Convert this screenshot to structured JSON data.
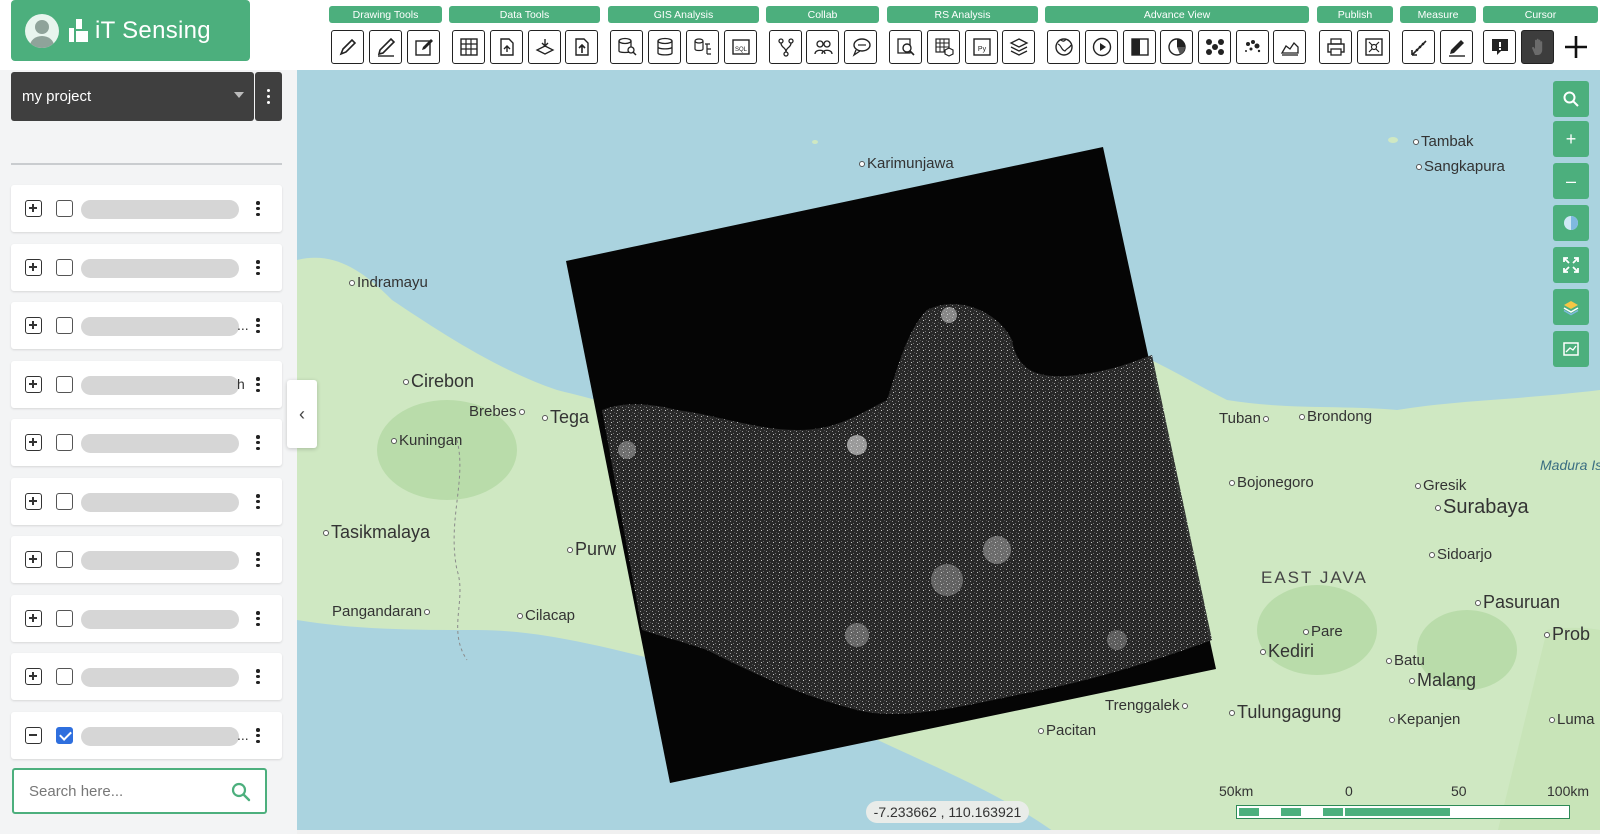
{
  "app": {
    "title": "iT Sensing"
  },
  "project": {
    "name": "my project"
  },
  "toolbar_groups": [
    "Drawing Tools",
    "Data Tools",
    "GIS Analysis",
    "Collab",
    "RS Analysis",
    "Advance View",
    "Publish",
    "Measure",
    "Cursor"
  ],
  "layers": [
    {
      "tail": "",
      "expanded": false,
      "checked": false
    },
    {
      "tail": "",
      "expanded": false,
      "checked": false
    },
    {
      "tail": "...",
      "expanded": false,
      "checked": false
    },
    {
      "tail": "h",
      "expanded": false,
      "checked": false
    },
    {
      "tail": "",
      "expanded": false,
      "checked": false
    },
    {
      "tail": "",
      "expanded": false,
      "checked": false
    },
    {
      "tail": "",
      "expanded": false,
      "checked": false
    },
    {
      "tail": "",
      "expanded": false,
      "checked": false
    },
    {
      "tail": "",
      "expanded": false,
      "checked": false
    },
    {
      "tail": "...",
      "expanded": true,
      "checked": true
    }
  ],
  "search": {
    "placeholder": "Search here..."
  },
  "map": {
    "places": {
      "karimunjawa": "Karimunjawa",
      "tambak": "Tambak",
      "sangkapura": "Sangkapura",
      "indramayu": "Indramayu",
      "cirebon": "Cirebon",
      "brebes": "Brebes",
      "tegal": "Tega",
      "kuningan": "Kuningan",
      "tasikmalaya": "Tasikmalaya",
      "purwokerto": "Purw",
      "pangandaran": "Pangandaran",
      "cilacap": "Cilacap",
      "tuban": "Tuban",
      "brondong": "Brondong",
      "bojonegoro": "Bojonegoro",
      "gresik": "Gresik",
      "surabaya": "Surabaya",
      "madura": "Madura Isl",
      "sidoarjo": "Sidoarjo",
      "east_java": "EAST JAVA",
      "pasuruan": "Pasuruan",
      "pare": "Pare",
      "kediri": "Kediri",
      "batu": "Batu",
      "malang": "Malang",
      "probolinggo": "Prob",
      "trenggalek": "Trenggalek",
      "tulungagung": "Tulungagung",
      "kepanjen": "Kepanjen",
      "lumajang": "Luma",
      "pacitan": "Pacitan"
    },
    "coordinates": "-7.233662 , 110.163921",
    "scale": {
      "left": "50km",
      "zero": "0",
      "mid": "50",
      "right": "100km"
    }
  },
  "colors": {
    "accent": "#4caf7d",
    "dark": "#3f3f3f",
    "water": "#aad3df",
    "land": "#cfe8c2"
  }
}
